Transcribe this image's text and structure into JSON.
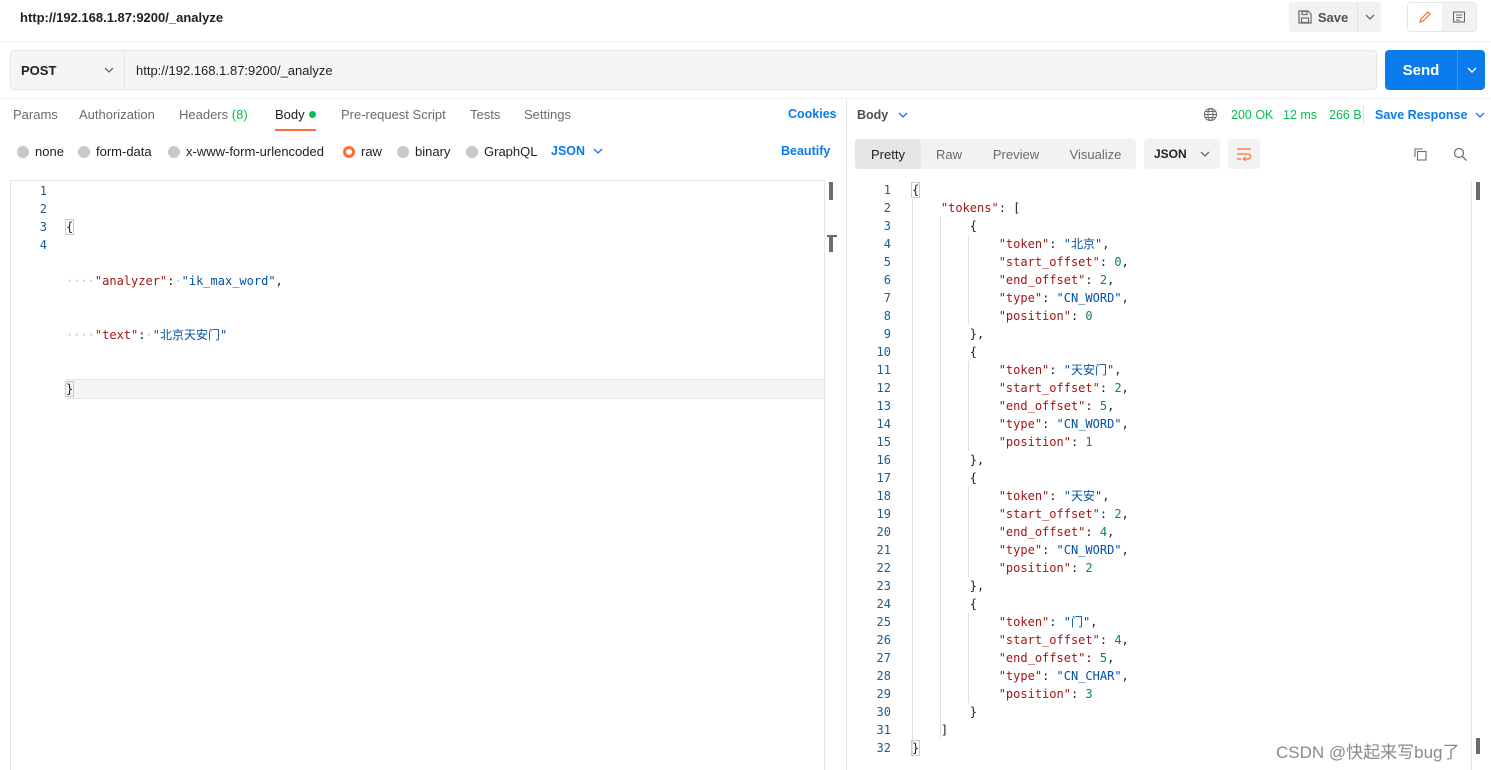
{
  "titlebar": {
    "title": "http://192.168.1.87:9200/_analyze",
    "save_label": "Save"
  },
  "request": {
    "method": "POST",
    "url": "http://192.168.1.87:9200/_analyze",
    "send_label": "Send",
    "tabs": [
      {
        "label": "Params"
      },
      {
        "label": "Authorization"
      },
      {
        "label": "Headers",
        "count": "(8)"
      },
      {
        "label": "Body"
      },
      {
        "label": "Pre-request Script"
      },
      {
        "label": "Tests"
      },
      {
        "label": "Settings"
      }
    ],
    "cookies_label": "Cookies",
    "body_types": [
      "none",
      "form-data",
      "x-www-form-urlencoded",
      "raw",
      "binary",
      "GraphQL"
    ],
    "selected_body_type": "raw",
    "raw_format": "JSON",
    "beautify_label": "Beautify",
    "line_numbers": [
      "1",
      "2",
      "3",
      "4"
    ],
    "code": {
      "l1": "{",
      "l2_key": "\"analyzer\"",
      "l2_val": "\"ik_max_word\"",
      "l3_key": "\"text\"",
      "l3_val": "\"北京天安门\"",
      "l4": "}"
    }
  },
  "response": {
    "body_label": "Body",
    "status": "200 OK",
    "time": "12 ms",
    "size": "266 B",
    "save_response_label": "Save Response",
    "view_tabs": [
      "Pretty",
      "Raw",
      "Preview",
      "Visualize"
    ],
    "active_view": "Pretty",
    "format": "JSON",
    "tokens": [
      {
        "token": "\"北京\"",
        "start_offset": "0",
        "end_offset": "2",
        "type": "\"CN_WORD\"",
        "position": "0"
      },
      {
        "token": "\"天安门\"",
        "start_offset": "2",
        "end_offset": "5",
        "type": "\"CN_WORD\"",
        "position": "1"
      },
      {
        "token": "\"天安\"",
        "start_offset": "2",
        "end_offset": "4",
        "type": "\"CN_WORD\"",
        "position": "2"
      },
      {
        "token": "\"门\"",
        "start_offset": "4",
        "end_offset": "5",
        "type": "\"CN_CHAR\"",
        "position": "3"
      }
    ],
    "keys": {
      "tokens": "\"tokens\"",
      "token": "\"token\"",
      "start_offset": "\"start_offset\"",
      "end_offset": "\"end_offset\"",
      "type": "\"type\"",
      "position": "\"position\""
    }
  },
  "watermark": "CSDN @快起来写bug了",
  "colors": {
    "accent": "#ff6c37",
    "primary": "#097bed",
    "success": "#0cbb52"
  }
}
